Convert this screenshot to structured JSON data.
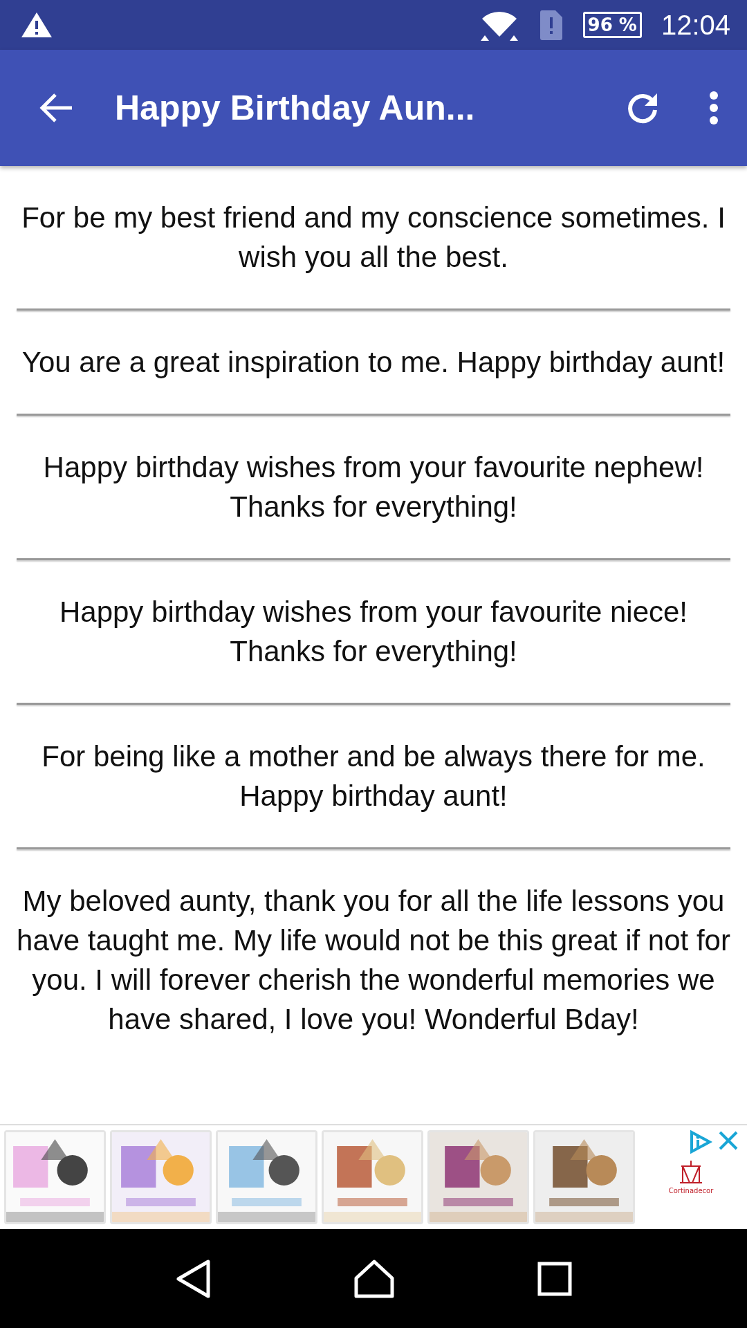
{
  "status_bar": {
    "battery": "96 %",
    "time": "12:04"
  },
  "app_bar": {
    "title": "Happy Birthday Aun..."
  },
  "messages": [
    "For be my best friend and my conscience sometimes. I wish you all the best.",
    "You are a great inspiration to me. Happy birthday aunt!",
    "Happy birthday wishes from your favourite nephew! Thanks for everything!",
    "Happy birthday wishes from your favourite niece! Thanks for everything!",
    "For being like a mother and be always there for me. Happy birthday aunt!",
    "My beloved aunty, thank you for all the life lessons you have taught me. My life would not be this great if not for you. I will forever cherish the wonderful memories we have shared, I love you! Wonderful Bday!"
  ],
  "ad": {
    "brand": "Cortinadecor"
  }
}
